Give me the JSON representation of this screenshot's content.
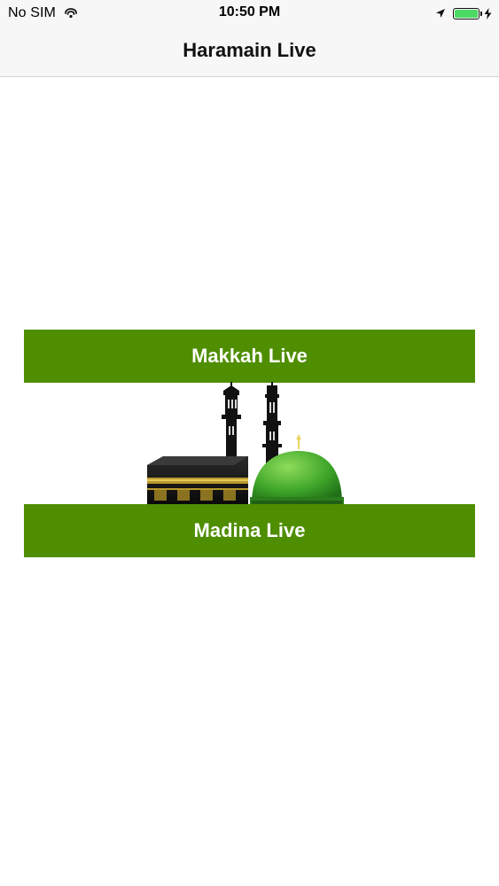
{
  "status_bar": {
    "carrier": "No SIM",
    "time": "10:50 PM",
    "battery_level": 1.0,
    "battery_color": "#4cd964",
    "icons": [
      "wifi-icon",
      "location-arrow-icon",
      "battery-icon",
      "charging-bolt-icon"
    ]
  },
  "nav": {
    "title": "Haramain Live"
  },
  "buttons": {
    "makkah_label": "Makkah Live",
    "madina_label": "Madina Live",
    "color": "#4f8e01"
  },
  "illustration": {
    "icon": "kaaba-and-green-dome-icon"
  }
}
